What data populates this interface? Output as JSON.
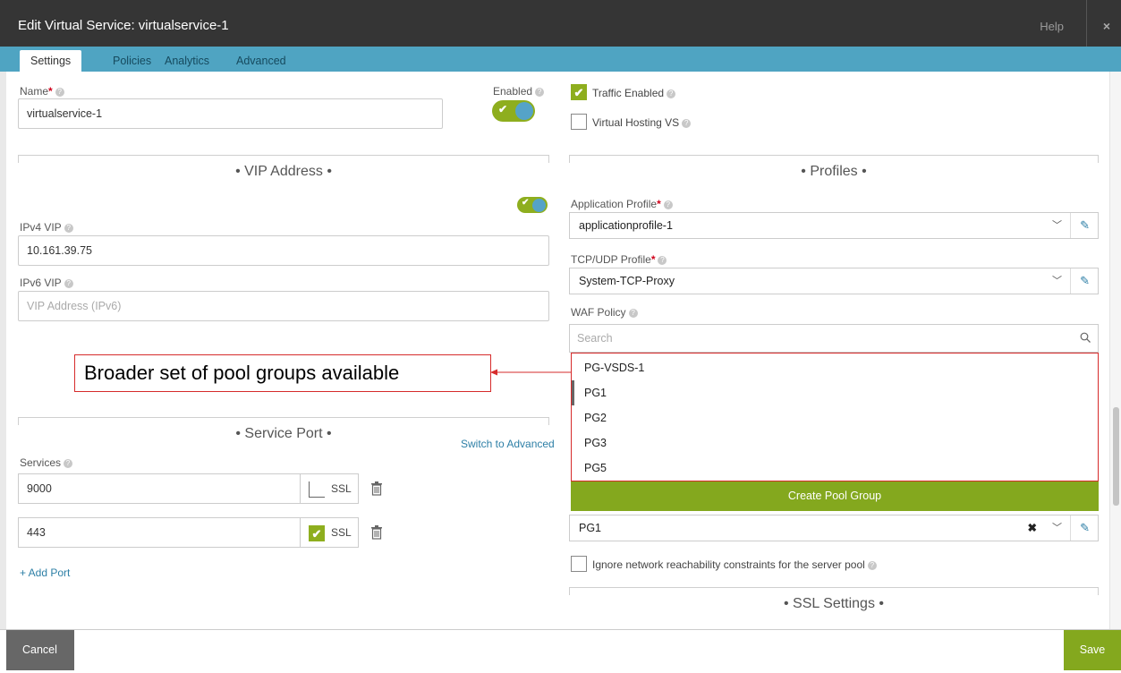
{
  "window": {
    "title": "Edit Virtual Service: virtualservice-1",
    "help": "Help",
    "close": "×"
  },
  "tabs": [
    "Settings",
    "Policies",
    "Analytics",
    "Advanced"
  ],
  "left": {
    "name_label": "Name",
    "name_value": "virtualservice-1",
    "enabled_label": "Enabled",
    "vip_section": "• VIP Address •",
    "ipv4_label": "IPv4 VIP",
    "ipv4_value": "10.161.39.75",
    "ipv6_label": "IPv6 VIP",
    "ipv6_placeholder": "VIP Address (IPv6)",
    "service_section": "• Service Port •",
    "switch_advanced": "Switch to Advanced",
    "services_label": "Services",
    "ports": [
      {
        "value": "9000",
        "ssl": false,
        "ssl_label": "SSL"
      },
      {
        "value": "443",
        "ssl": true,
        "ssl_label": "SSL"
      }
    ],
    "add_port": "+ Add Port"
  },
  "callout": "Broader set of pool groups available",
  "right": {
    "traffic_enabled": "Traffic Enabled",
    "virtual_hosting": "Virtual Hosting VS",
    "profiles_section": "• Profiles •",
    "app_profile_label": "Application Profile",
    "app_profile_value": "applicationprofile-1",
    "tcp_profile_label": "TCP/UDP Profile",
    "tcp_profile_value": "System-TCP-Proxy",
    "waf_label": "WAF Policy",
    "search_placeholder": "Search",
    "pool_groups": [
      "PG-VSDS-1",
      "PG1",
      "PG2",
      "PG3",
      "PG5"
    ],
    "create_pool_group": "Create Pool Group",
    "selected_pool_group": "PG1",
    "ignore_constraints": "Ignore network reachability constraints for the server pool",
    "ssl_section": "• SSL Settings •"
  },
  "footer": {
    "cancel": "Cancel",
    "save": "Save"
  },
  "colors": {
    "accent_green": "#84a81e",
    "tab_blue": "#4fa4c2",
    "highlight_red": "#d62b2b"
  }
}
